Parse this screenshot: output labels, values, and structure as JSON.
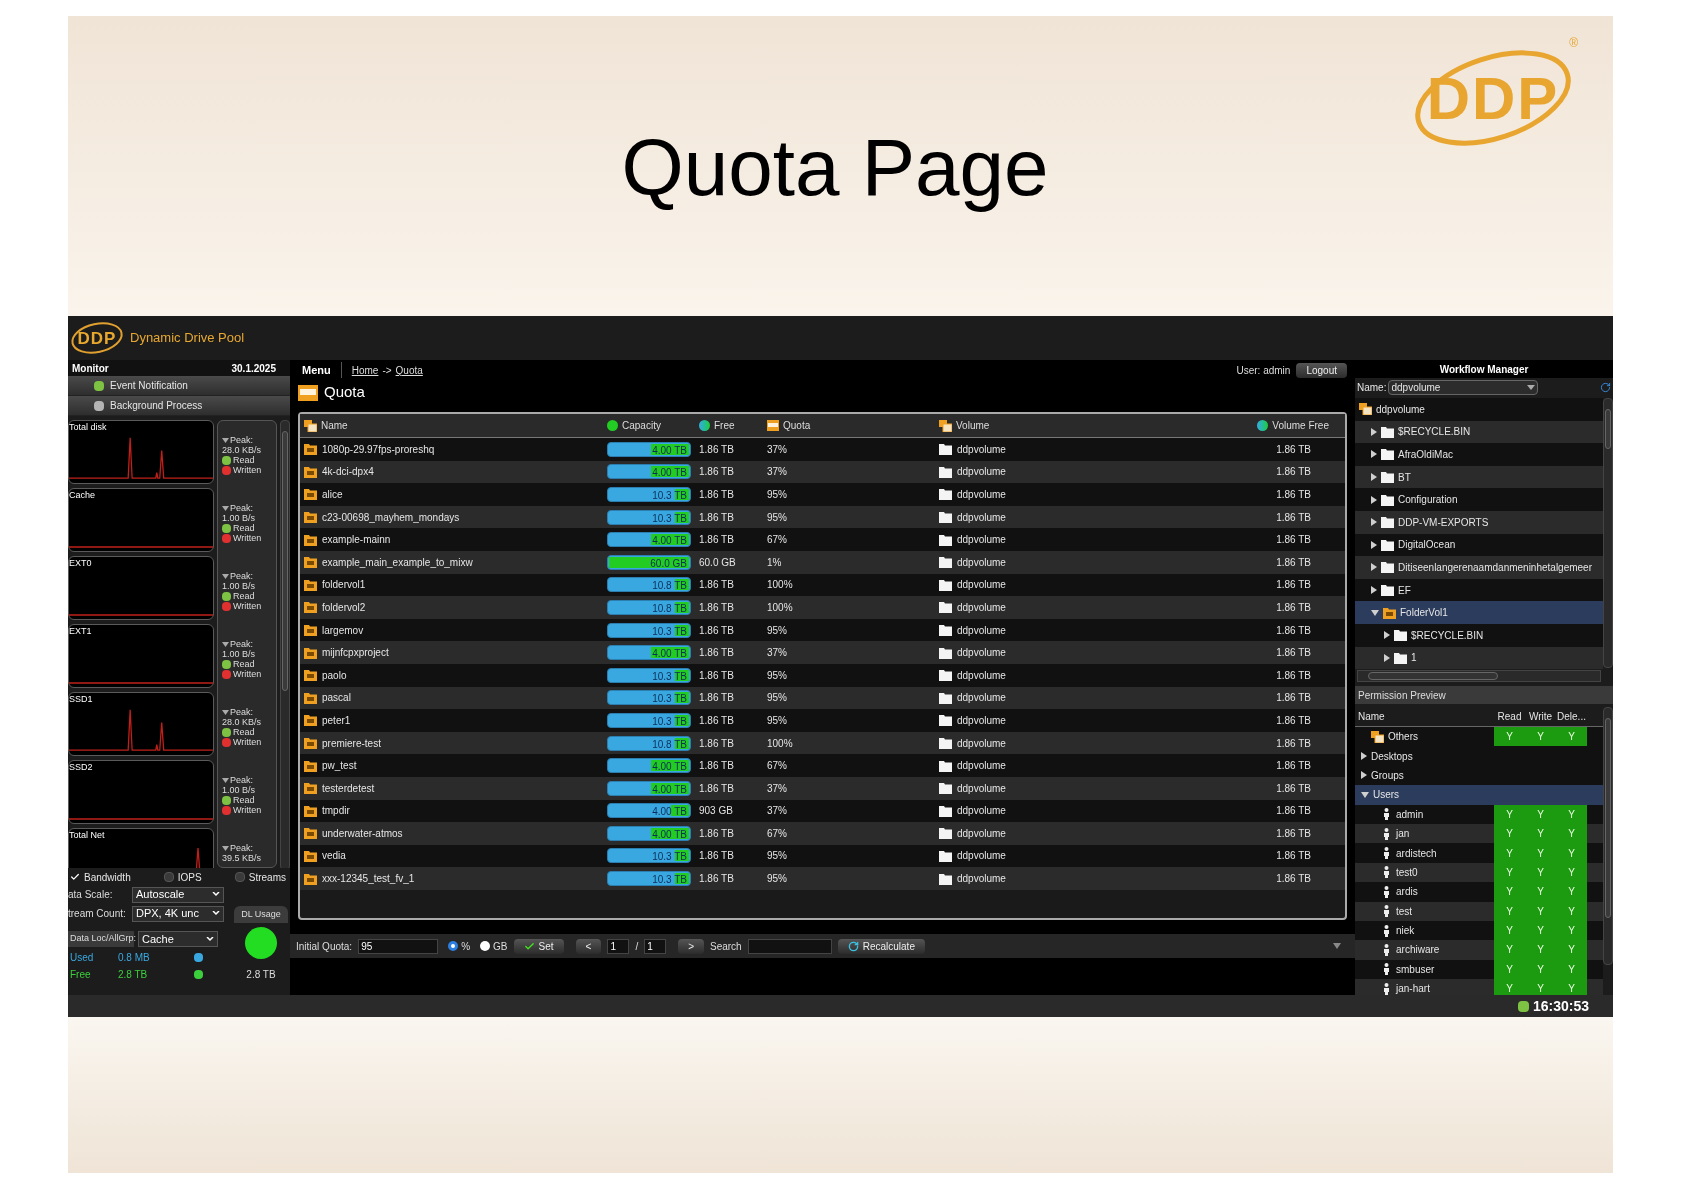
{
  "slide": {
    "title": "Quota Page",
    "logo_text": "DDP",
    "logo_mark": "®"
  },
  "header": {
    "logo_text": "DDP",
    "brand": "Dynamic Drive Pool"
  },
  "monitor": {
    "title": "Monitor",
    "date": "30.1.2025",
    "notifications": [
      {
        "label": "Event Notification",
        "color": "#7dc242"
      },
      {
        "label": "Background Process",
        "color": "#b4b4b4"
      }
    ],
    "graphs": [
      {
        "name": "Total disk",
        "kind": "two_spikes",
        "peak_label": "Peak:",
        "peak": "28.0 KB/s",
        "legend": [
          {
            "label": "Read",
            "color": "#7dc242"
          },
          {
            "label": "Written",
            "color": "#e03030"
          }
        ]
      },
      {
        "name": "Cache",
        "kind": "flat",
        "peak_label": "Peak:",
        "peak": "1.00 B/s",
        "legend": [
          {
            "label": "Read",
            "color": "#7dc242"
          },
          {
            "label": "Written",
            "color": "#e03030"
          }
        ]
      },
      {
        "name": "EXT0",
        "kind": "flat",
        "peak_label": "Peak:",
        "peak": "1.00 B/s",
        "legend": [
          {
            "label": "Read",
            "color": "#7dc242"
          },
          {
            "label": "Written",
            "color": "#e03030"
          }
        ]
      },
      {
        "name": "EXT1",
        "kind": "flat",
        "peak_label": "Peak:",
        "peak": "1.00 B/s",
        "legend": [
          {
            "label": "Read",
            "color": "#7dc242"
          },
          {
            "label": "Written",
            "color": "#e03030"
          }
        ]
      },
      {
        "name": "SSD1",
        "kind": "two_spikes",
        "peak_label": "Peak:",
        "peak": "28.0 KB/s",
        "legend": [
          {
            "label": "Read",
            "color": "#7dc242"
          },
          {
            "label": "Written",
            "color": "#e03030"
          }
        ]
      },
      {
        "name": "SSD2",
        "kind": "flat",
        "peak_label": "Peak:",
        "peak": "1.00 B/s",
        "legend": [
          {
            "label": "Read",
            "color": "#7dc242"
          },
          {
            "label": "Written",
            "color": "#e03030"
          }
        ]
      },
      {
        "name": "Total Net",
        "kind": "late_spike",
        "peak_label": "Peak:",
        "peak": "39.5 KB/s"
      }
    ],
    "options": [
      {
        "label": "Bandwidth",
        "checked": true
      },
      {
        "label": "IOPS",
        "checked": false
      },
      {
        "label": "Streams",
        "checked": false
      }
    ],
    "selects": [
      {
        "label": "ata Scale:",
        "value": "Autoscale"
      },
      {
        "label": "tream Count:",
        "value": "DPX, 4K unc"
      }
    ],
    "location": {
      "label": "Data Loc/AllGrp:",
      "value": "Cache"
    },
    "usage": [
      {
        "label": "Used",
        "value": "0.8 MB",
        "color": "#3aa8e0"
      },
      {
        "label": "Free",
        "value": "2.8 TB",
        "color": "#3ccf3c"
      }
    ],
    "dl_usage": {
      "tab": "DL Usage",
      "total": "2.8 TB"
    }
  },
  "nav": {
    "menu": "Menu",
    "breadcrumb": [
      "Home",
      "Quota"
    ],
    "separator": "->",
    "user": "User: admin",
    "logout": "Logout"
  },
  "page_title": "Quota",
  "quota_table": {
    "columns": [
      {
        "kind": "name",
        "label": "Name"
      },
      {
        "kind": "capacity",
        "label": "Capacity"
      },
      {
        "kind": "free",
        "label": "Free"
      },
      {
        "kind": "quota",
        "label": "Quota"
      },
      {
        "kind": "volume",
        "label": "Volume"
      },
      {
        "kind": "volume_free",
        "label": "Volume Free"
      }
    ],
    "rows": [
      {
        "name": "1080p-29.97fps-proreshq",
        "capacity": "4.00 TB",
        "level": 0.47,
        "free": "1.86 TB",
        "quota": "37%",
        "volume": "ddpvolume",
        "volume_free": "1.86 TB"
      },
      {
        "name": "4k-dci-dpx4",
        "capacity": "4.00 TB",
        "level": 0.47,
        "free": "1.86 TB",
        "quota": "37%",
        "volume": "ddpvolume",
        "volume_free": "1.86 TB"
      },
      {
        "name": "alice",
        "capacity": "10.3 TB",
        "level": 0.18,
        "free": "1.86 TB",
        "quota": "95%",
        "volume": "ddpvolume",
        "volume_free": "1.86 TB"
      },
      {
        "name": "c23-00698_mayhem_mondays",
        "capacity": "10.3 TB",
        "level": 0.18,
        "free": "1.86 TB",
        "quota": "95%",
        "volume": "ddpvolume",
        "volume_free": "1.86 TB"
      },
      {
        "name": "example-mainn",
        "capacity": "4.00 TB",
        "level": 0.47,
        "free": "1.86 TB",
        "quota": "67%",
        "volume": "ddpvolume",
        "volume_free": "1.86 TB"
      },
      {
        "name": "example_main_example_to_mixw",
        "capacity": "60.0 GB",
        "level": 1,
        "free": "60.0 GB",
        "quota": "1%",
        "volume": "ddpvolume",
        "volume_free": "1.86 TB"
      },
      {
        "name": "foldervol1",
        "capacity": "10.8 TB",
        "level": 0.17,
        "free": "1.86 TB",
        "quota": "100%",
        "volume": "ddpvolume",
        "volume_free": "1.86 TB"
      },
      {
        "name": "foldervol2",
        "capacity": "10.8 TB",
        "level": 0.17,
        "free": "1.86 TB",
        "quota": "100%",
        "volume": "ddpvolume",
        "volume_free": "1.86 TB"
      },
      {
        "name": "largemov",
        "capacity": "10.3 TB",
        "level": 0.18,
        "free": "1.86 TB",
        "quota": "95%",
        "volume": "ddpvolume",
        "volume_free": "1.86 TB"
      },
      {
        "name": "mijnfcpxproject",
        "capacity": "4.00 TB",
        "level": 0.47,
        "free": "1.86 TB",
        "quota": "37%",
        "volume": "ddpvolume",
        "volume_free": "1.86 TB"
      },
      {
        "name": "paolo",
        "capacity": "10.3 TB",
        "level": 0.18,
        "free": "1.86 TB",
        "quota": "95%",
        "volume": "ddpvolume",
        "volume_free": "1.86 TB"
      },
      {
        "name": "pascal",
        "capacity": "10.3 TB",
        "level": 0.18,
        "free": "1.86 TB",
        "quota": "95%",
        "volume": "ddpvolume",
        "volume_free": "1.86 TB"
      },
      {
        "name": "peter1",
        "capacity": "10.3 TB",
        "level": 0.18,
        "free": "1.86 TB",
        "quota": "95%",
        "volume": "ddpvolume",
        "volume_free": "1.86 TB"
      },
      {
        "name": "premiere-test",
        "capacity": "10.8 TB",
        "level": 0.17,
        "free": "1.86 TB",
        "quota": "100%",
        "volume": "ddpvolume",
        "volume_free": "1.86 TB"
      },
      {
        "name": "pw_test",
        "capacity": "4.00 TB",
        "level": 0.47,
        "free": "1.86 TB",
        "quota": "67%",
        "volume": "ddpvolume",
        "volume_free": "1.86 TB"
      },
      {
        "name": "testerdetest",
        "capacity": "4.00 TB",
        "level": 0.47,
        "free": "1.86 TB",
        "quota": "37%",
        "volume": "ddpvolume",
        "volume_free": "1.86 TB"
      },
      {
        "name": "tmpdir",
        "capacity": "4.00 TB",
        "level": 0.23,
        "free": "903 GB",
        "quota": "37%",
        "volume": "ddpvolume",
        "volume_free": "1.86 TB"
      },
      {
        "name": "underwater-atmos",
        "capacity": "4.00 TB",
        "level": 0.47,
        "free": "1.86 TB",
        "quota": "67%",
        "volume": "ddpvolume",
        "volume_free": "1.86 TB"
      },
      {
        "name": "vedia",
        "capacity": "10.3 TB",
        "level": 0.18,
        "free": "1.86 TB",
        "quota": "95%",
        "volume": "ddpvolume",
        "volume_free": "1.86 TB"
      },
      {
        "name": "xxx-12345_test_fv_1",
        "capacity": "10.3 TB",
        "level": 0.18,
        "free": "1.86 TB",
        "quota": "95%",
        "volume": "ddpvolume",
        "volume_free": "1.86 TB"
      }
    ]
  },
  "toolbar": {
    "quota_label": "Initial Quota:",
    "quota_value": "95",
    "units": [
      {
        "label": "%",
        "selected": true
      },
      {
        "label": "GB",
        "selected": false
      }
    ],
    "set": "Set",
    "prev": "<",
    "page": "1",
    "page_separator": "/",
    "pages": "1",
    "next": ">",
    "search_label": "Search",
    "recalculate": "Recalculate"
  },
  "workflow": {
    "title": "Workflow Manager",
    "name_label": "Name:",
    "name_value": "ddpvolume",
    "tree": {
      "label": "ddpvolume",
      "kind": "volume",
      "children": [
        {
          "label": "$RECYCLE.BIN",
          "kind": "folder",
          "expanded": false,
          "selected": false
        },
        {
          "label": "AfraOldiMac",
          "kind": "folder",
          "expanded": false,
          "selected": false
        },
        {
          "label": "BT",
          "kind": "folder",
          "expanded": false,
          "selected": false
        },
        {
          "label": "Configuration",
          "kind": "folder",
          "expanded": false,
          "selected": false
        },
        {
          "label": "DDP-VM-EXPORTS",
          "kind": "folder",
          "expanded": false,
          "selected": false
        },
        {
          "label": "DigitalOcean",
          "kind": "folder",
          "expanded": false,
          "selected": false
        },
        {
          "label": "Ditiseenlangerenaamdanmeninhetalgemeer",
          "kind": "folder",
          "expanded": false,
          "selected": false
        },
        {
          "label": "EF",
          "kind": "folder",
          "expanded": false,
          "selected": false
        },
        {
          "label": "FolderVol1",
          "kind": "folder_volume",
          "expanded": true,
          "selected": true,
          "children": [
            {
              "label": "$RECYCLE.BIN",
              "kind": "folder",
              "expanded": false,
              "selected": false
            },
            {
              "label": "1",
              "kind": "folder",
              "expanded": false,
              "selected": false
            }
          ]
        }
      ]
    }
  },
  "permissions": {
    "title": "Permission Preview",
    "columns": [
      "Name",
      "Read",
      "Write",
      "Dele..."
    ],
    "rows": [
      {
        "kind": "group",
        "name": "Others",
        "selected": false,
        "cells": [
          "Y",
          "Y",
          "Y"
        ]
      },
      {
        "kind": "category",
        "name": "Desktops",
        "expanded": false,
        "selected": false
      },
      {
        "kind": "category",
        "name": "Groups",
        "expanded": false,
        "selected": false
      },
      {
        "kind": "category",
        "name": "Users",
        "expanded": true,
        "selected": true,
        "children": [
          {
            "name": "admin",
            "cells": [
              "Y",
              "Y",
              "Y"
            ]
          },
          {
            "name": "jan",
            "cells": [
              "Y",
              "Y",
              "Y"
            ]
          },
          {
            "name": "ardistech",
            "cells": [
              "Y",
              "Y",
              "Y"
            ]
          },
          {
            "name": "test0",
            "cells": [
              "Y",
              "Y",
              "Y"
            ]
          },
          {
            "name": "ardis",
            "cells": [
              "Y",
              "Y",
              "Y"
            ]
          },
          {
            "name": "test",
            "cells": [
              "Y",
              "Y",
              "Y"
            ]
          },
          {
            "name": "niek",
            "cells": [
              "Y",
              "Y",
              "Y"
            ]
          },
          {
            "name": "archiware",
            "cells": [
              "Y",
              "Y",
              "Y"
            ]
          },
          {
            "name": "smbuser",
            "cells": [
              "Y",
              "Y",
              "Y"
            ]
          },
          {
            "name": "jan-hart",
            "cells": [
              "Y",
              "Y",
              "Y"
            ]
          }
        ]
      }
    ]
  },
  "status_bar": {
    "clock": "16:30:53"
  }
}
